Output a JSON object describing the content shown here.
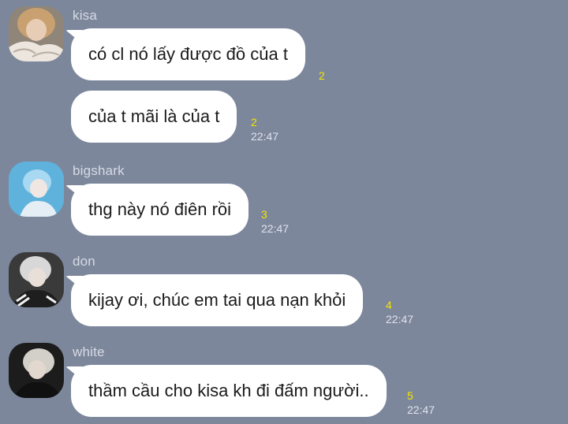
{
  "colors": {
    "background": "#7d879c",
    "bubble": "#ffffff",
    "read_count": "#f2e600",
    "timestamp": "#dfe3eb"
  },
  "messages": [
    {
      "sender": "kisa",
      "avatar_icon": "avatar-kisa-icon",
      "text": "có cl nó lấy được đồ của t",
      "read_count": "2",
      "time": ""
    },
    {
      "sender": "",
      "text": "của t mãi là của t",
      "read_count": "2",
      "time": "22:47"
    },
    {
      "sender": "bigshark",
      "avatar_icon": "avatar-bigshark-icon",
      "text": "thg này nó điên rồi",
      "read_count": "3",
      "time": "22:47"
    },
    {
      "sender": "don",
      "avatar_icon": "avatar-don-icon",
      "text": "kijay ơi, chúc em tai qua nạn khỏi",
      "read_count": "4",
      "time": "22:47"
    },
    {
      "sender": "white",
      "avatar_icon": "avatar-white-icon",
      "text": "thầm cầu cho kisa kh đi đấm người..",
      "read_count": "5",
      "time": "22:47"
    }
  ]
}
